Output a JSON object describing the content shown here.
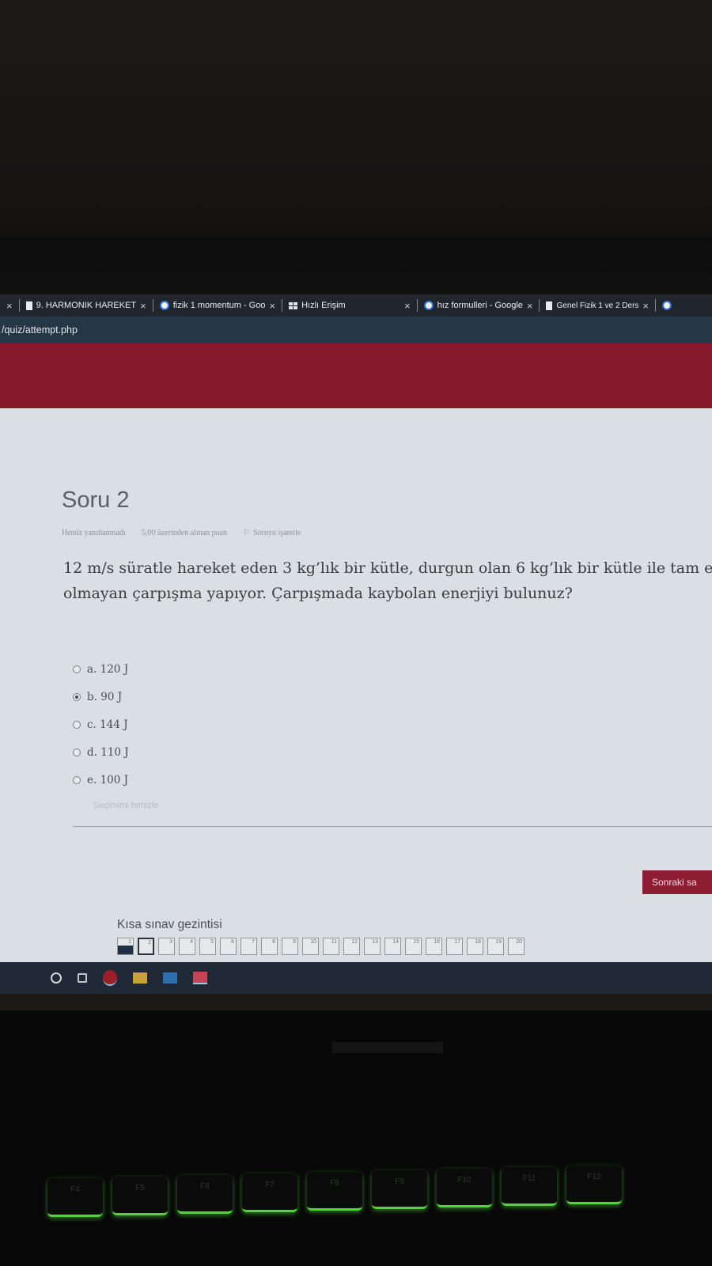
{
  "browser": {
    "tabs": [
      {
        "title": "9. HARMONIK HAREKET",
        "icon": "document-icon"
      },
      {
        "title": "fizik 1 momentum - Goo",
        "icon": "google-icon"
      },
      {
        "title": "Hızlı Erişim",
        "icon": "apps-grid-icon"
      },
      {
        "title": "hız formulleri - Google",
        "icon": "google-icon"
      },
      {
        "title": "Genel Fizik 1 ve 2 Ders",
        "icon": "document-icon"
      }
    ],
    "url": "/quiz/attempt.php"
  },
  "question": {
    "title": "Soru 2",
    "status": "Henüz yanıtlanmadı",
    "points": "5,00 üzerinden alınan puan",
    "flag_label": "Soruyu işaretle",
    "text_line1": "12 m/s süratle hareket eden 3 kg’lık bir kütle, durgun olan 6 kg’lık bir kütle ile tam e",
    "text_line2": "olmayan çarpışma yapıyor. Çarpışmada kaybolan enerjiyi bulunuz?",
    "options": [
      {
        "label": "a. 120 J",
        "selected": false
      },
      {
        "label": "b. 90 J",
        "selected": true
      },
      {
        "label": "c. 144 J",
        "selected": false
      },
      {
        "label": "d. 110 J",
        "selected": false
      },
      {
        "label": "e. 100 J",
        "selected": false
      }
    ],
    "clear_label": "Seçimimi temizle"
  },
  "next_button": "Sonraki sa",
  "quiz_nav": {
    "title": "Kısa sınav gezintisi",
    "numbers": [
      "1",
      "2",
      "3",
      "4",
      "5",
      "6",
      "7",
      "8",
      "9",
      "10",
      "11",
      "12",
      "13",
      "14",
      "15",
      "16",
      "17",
      "18",
      "19",
      "20"
    ],
    "answered": [
      1
    ],
    "current": 2
  },
  "keyboard_labels": [
    "F4",
    "F5",
    "F6",
    "F7",
    "F8",
    "F9",
    "F10",
    "F11",
    "F12"
  ],
  "colors": {
    "accent_red": "#861a2c",
    "page_bg": "#dadfe3",
    "keyboard_glow": "#4dd83a"
  }
}
